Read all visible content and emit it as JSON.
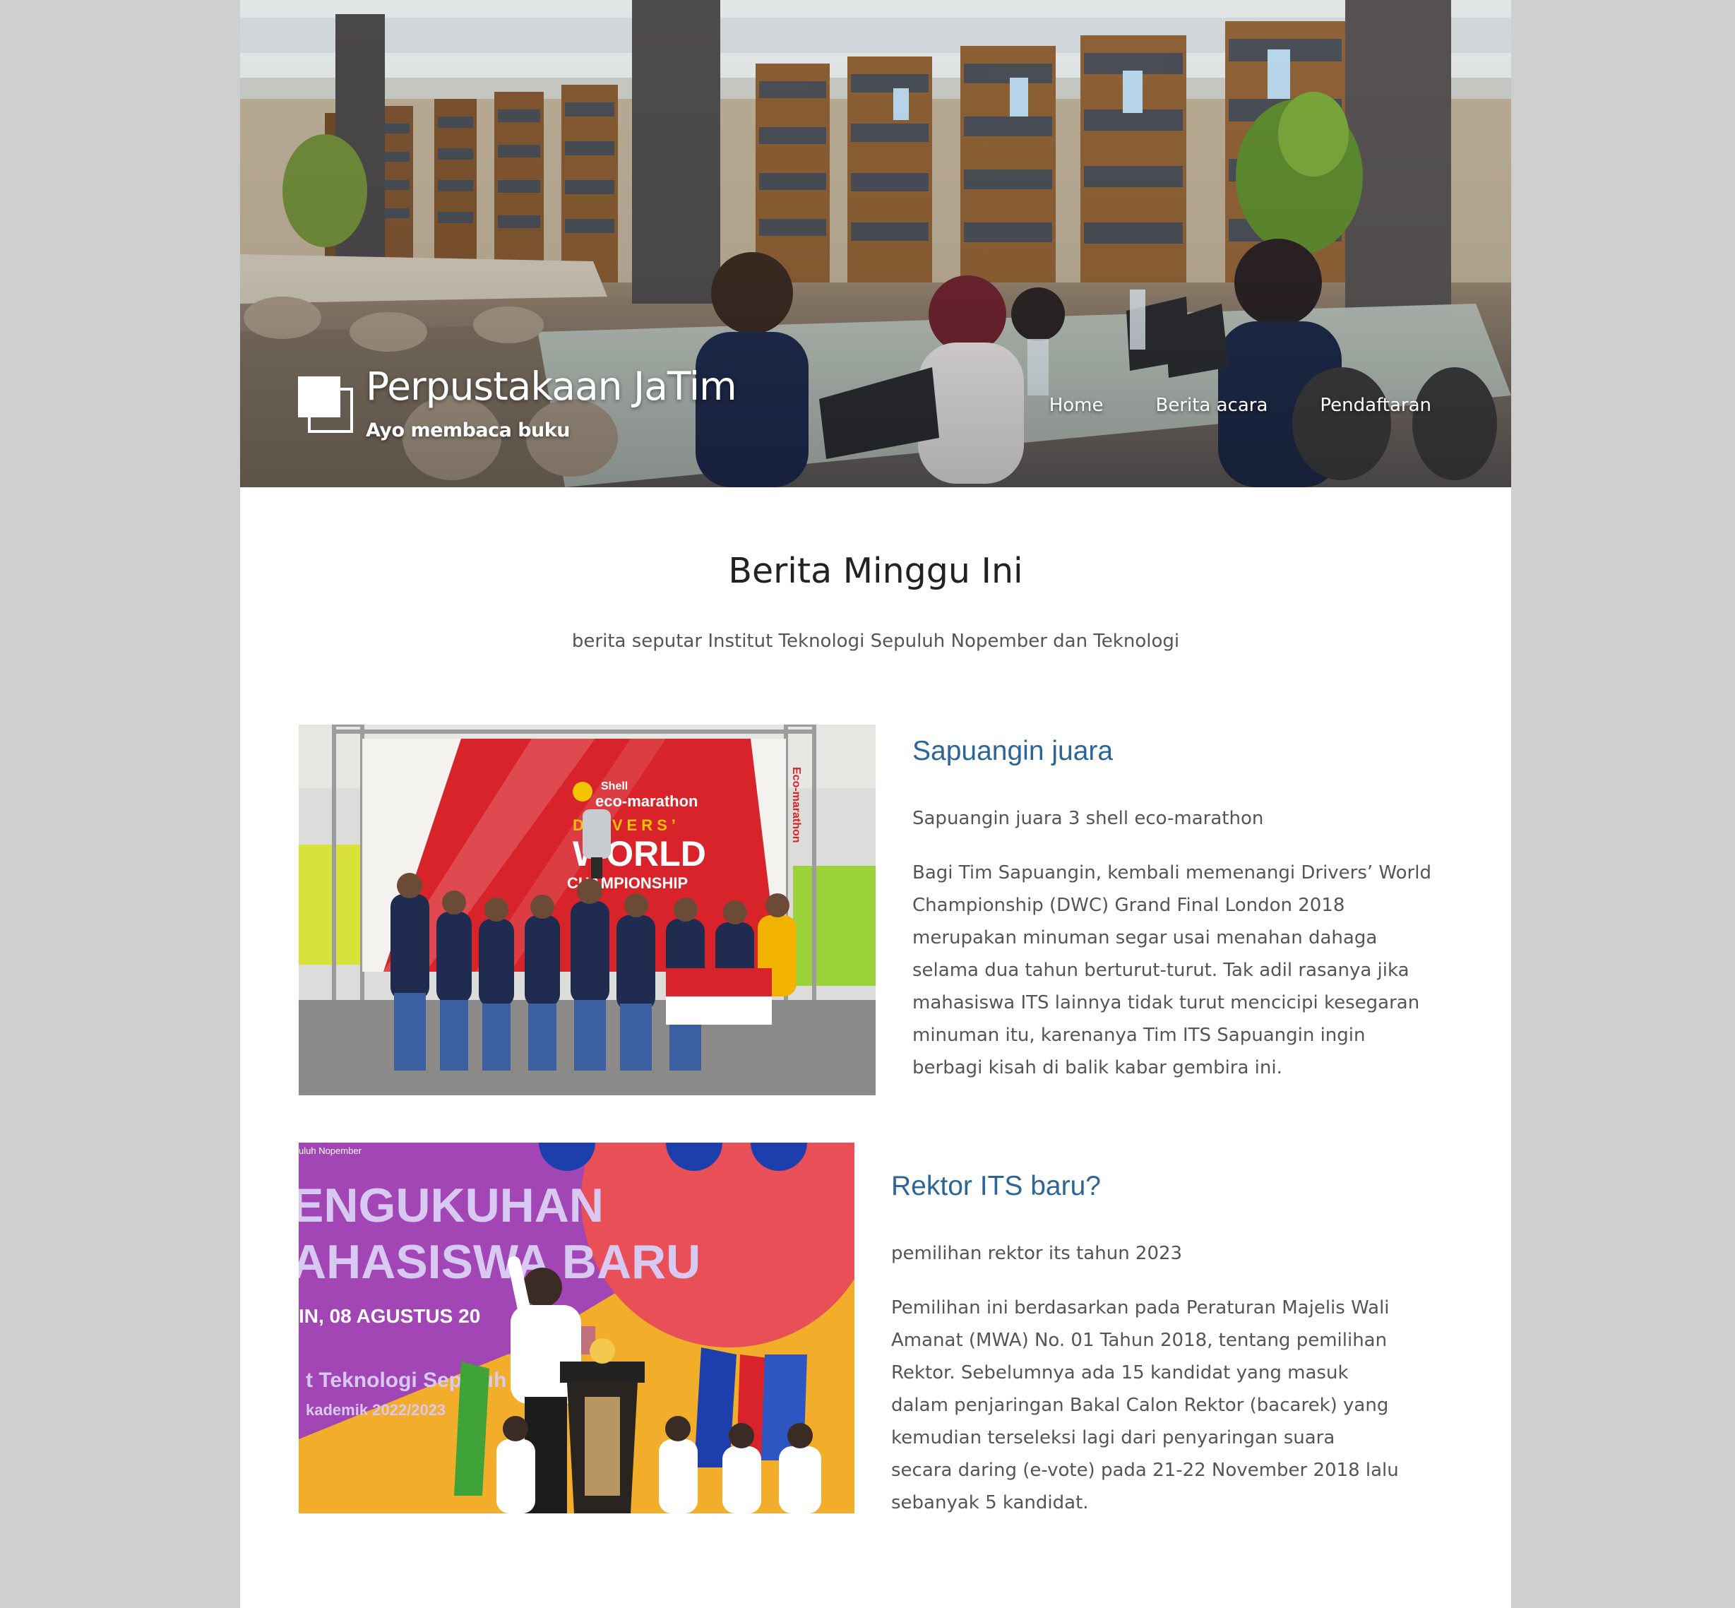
{
  "site": {
    "title": "Perpustakaan JaTim",
    "tagline": "Ayo membaca buku"
  },
  "nav": {
    "items": [
      {
        "label": "Home"
      },
      {
        "label": "Berita acara"
      },
      {
        "label": "Pendaftaran"
      }
    ]
  },
  "section": {
    "title": "Berita Minggu Ini",
    "subtitle": "berita seputar Institut Teknologi Sepuluh Nopember dan Teknologi"
  },
  "articles": [
    {
      "title": "Sapuangin juara",
      "lead": "Sapuangin juara 3 shell eco-marathon",
      "body": "Bagi Tim Sapuangin, kembali memenangi Drivers’ World Championship (DWC) Grand Final London 2018 merupakan minuman segar usai menahan dahaga selama dua tahun berturut-turut. Tak adil rasanya jika mahasiswa ITS lainnya tidak turut mencicipi kesegaran minuman itu, karenanya Tim ITS Sapuangin ingin berbagi kisah di balik kabar gembira ini.",
      "image_text": {
        "brand": "Shell",
        "event": "eco-marathon",
        "line1": "DRIVERS’",
        "line2": "WORLD",
        "line3": "CHAMPIONSHIP",
        "side": "Eco-marathon"
      }
    },
    {
      "title": "Rektor ITS baru?",
      "lead": "pemilihan rektor its tahun 2023",
      "body": "Pemilihan ini berdasarkan pada Peraturan Majelis Wali Amanat (MWA) No. 01 Tahun 2018, tentang pemilihan Rektor. Sebelumnya ada 15 kandidat yang masuk dalam penjaringan Bakal Calon Rektor (bacarek) yang kemudian terseleksi lagi dari penyaringan suara secara daring (e-vote) pada 21-22 November 2018 lalu sebanyak 5 kandidat.",
      "image_text": {
        "top": "uluh Nopember",
        "line1": "ENGUKUHAN",
        "line2": "AHASISWA BARU",
        "date": "IN, 08 AGUSTUS 20",
        "institute": "t Teknologi Sepuluh",
        "year": "kademik 2022/2023"
      }
    }
  ],
  "colors": {
    "background": "#cfcfcf",
    "link": "#2d6596",
    "text": "#555555",
    "heading": "#222222"
  }
}
